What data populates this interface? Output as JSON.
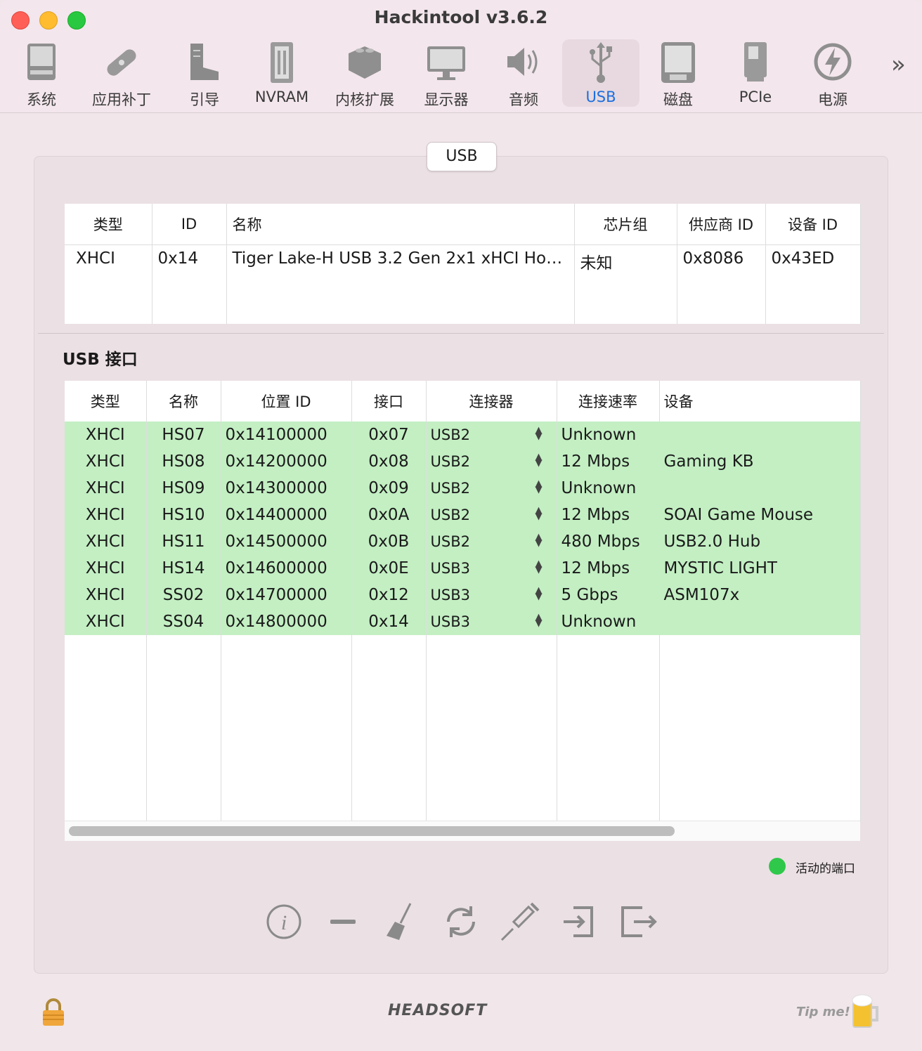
{
  "window": {
    "title": "Hackintool v3.6.2"
  },
  "toolbar": {
    "items": [
      {
        "label": "系统",
        "icon": "computer-icon"
      },
      {
        "label": "应用补丁",
        "icon": "bandage-icon"
      },
      {
        "label": "引导",
        "icon": "boot-icon"
      },
      {
        "label": "NVRAM",
        "icon": "memory-icon"
      },
      {
        "label": "内核扩展",
        "icon": "lego-brick-icon"
      },
      {
        "label": "显示器",
        "icon": "monitor-icon"
      },
      {
        "label": "音频",
        "icon": "speaker-icon"
      },
      {
        "label": "USB",
        "icon": "usb-icon",
        "active": true
      },
      {
        "label": "磁盘",
        "icon": "disk-icon"
      },
      {
        "label": "PCIe",
        "icon": "pcie-card-icon"
      },
      {
        "label": "电源",
        "icon": "power-icon"
      }
    ],
    "more": "»",
    "active_color": "#1d6fe0"
  },
  "segment": {
    "label": "USB"
  },
  "controllers": {
    "headers": [
      "类型",
      "ID",
      "名称",
      "芯片组",
      "供应商 ID",
      "设备 ID"
    ],
    "rows": [
      [
        "XHCI",
        "0x14",
        "Tiger Lake-H USB 3.2 Gen 2x1 xHCI Hos...",
        "未知",
        "0x8086",
        "0x43ED"
      ]
    ]
  },
  "ports": {
    "title": "USB 接口",
    "headers": [
      "类型",
      "名称",
      "位置 ID",
      "接口",
      "连接器",
      "连接速率",
      "设备"
    ],
    "rows": [
      [
        "XHCI",
        "HS07",
        "0x14100000",
        "0x07",
        "USB2",
        "Unknown",
        ""
      ],
      [
        "XHCI",
        "HS08",
        "0x14200000",
        "0x08",
        "USB2",
        "12 Mbps",
        "Gaming KB"
      ],
      [
        "XHCI",
        "HS09",
        "0x14300000",
        "0x09",
        "USB2",
        "Unknown",
        ""
      ],
      [
        "XHCI",
        "HS10",
        "0x14400000",
        "0x0A",
        "USB2",
        "12 Mbps",
        "SOAI Game Mouse"
      ],
      [
        "XHCI",
        "HS11",
        "0x14500000",
        "0x0B",
        "USB2",
        "480 Mbps",
        "USB2.0 Hub"
      ],
      [
        "XHCI",
        "HS14",
        "0x14600000",
        "0x0E",
        "USB3",
        "12 Mbps",
        "MYSTIC LIGHT"
      ],
      [
        "XHCI",
        "SS02",
        "0x14700000",
        "0x12",
        "USB3",
        "5 Gbps",
        "ASM107x"
      ],
      [
        "XHCI",
        "SS04",
        "0x14800000",
        "0x14",
        "USB3",
        "Unknown",
        ""
      ]
    ],
    "active_row_color": "#c3efc3"
  },
  "legend": {
    "label": "活动的端口",
    "color": "#2fc84a"
  },
  "actions": [
    "info-icon",
    "minus-icon",
    "broom-icon",
    "refresh-icon",
    "syringe-icon",
    "import-icon",
    "export-icon"
  ],
  "footer": {
    "brand": "HEADSOFT",
    "tip": "Tip me!"
  }
}
